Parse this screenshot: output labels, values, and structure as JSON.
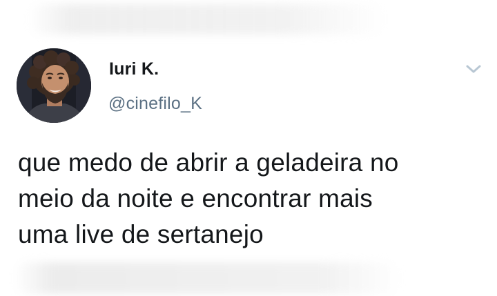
{
  "tweet": {
    "display_name": "Iuri K.",
    "handle": "@cinefilo_K",
    "text_lines": [
      "que medo de abrir a geladeira no",
      "meio da noite e encontrar mais",
      "uma live de sertanejo"
    ],
    "icons": {
      "avatar": "user-avatar-photo",
      "menu": "chevron-down-icon"
    }
  },
  "colors": {
    "name_text": "#14171a",
    "handle_text": "#5b7083",
    "chevron": "#b8c7d3",
    "background": "#ffffff"
  }
}
